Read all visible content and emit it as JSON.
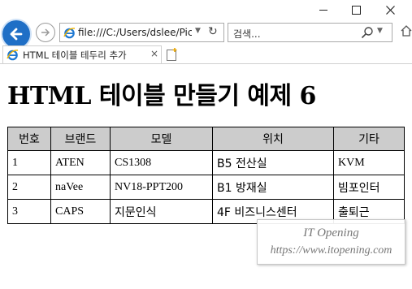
{
  "window": {
    "minimize_icon": "minimize-icon",
    "maximize_icon": "maximize-icon",
    "close_glyph": "✕"
  },
  "nav": {
    "address_value": "file:///C:/Users/dslee/Pictu",
    "search_placeholder": "검색...",
    "accent_color": "#1f6fc6"
  },
  "tab": {
    "title": "HTML 테이블 테두리 추가",
    "close_glyph": "×"
  },
  "page": {
    "title": "HTML 테이블 만들기 예제 6"
  },
  "table": {
    "headers": [
      "번호",
      "브랜드",
      "모델",
      "위치",
      "기타"
    ],
    "header_bg": "#cccccc",
    "rows": [
      [
        "1",
        "ATEN",
        "CS1308",
        "B5 전산실",
        "KVM"
      ],
      [
        "2",
        "naVee",
        "NV18-PPT200",
        "B1 방재실",
        "빔포인터"
      ],
      [
        "3",
        "CAPS",
        "지문인식",
        "4F 비즈니스센터",
        "출퇴근"
      ]
    ]
  },
  "watermark": {
    "line1": "IT Opening",
    "line2": "https://www.itopening.com"
  }
}
